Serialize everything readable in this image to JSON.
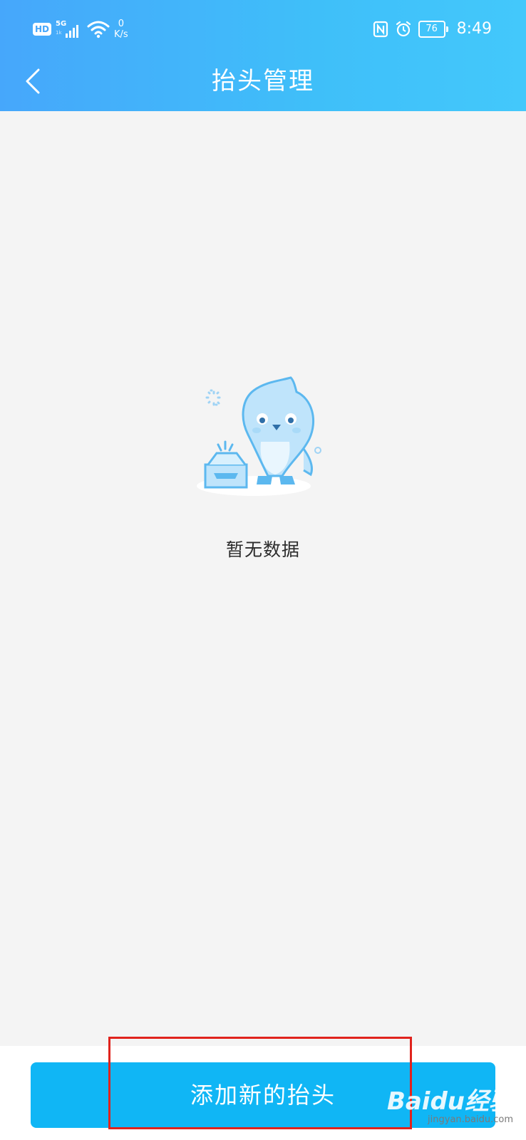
{
  "status_bar": {
    "hd": "HD",
    "network": "5G",
    "network_sub": "1k",
    "speed_value": "0",
    "speed_unit": "K/s",
    "battery": "76",
    "time": "8:49"
  },
  "nav": {
    "title": "抬头管理",
    "back_icon": "chevron-left-icon"
  },
  "empty_state": {
    "message": "暂无数据",
    "illustration": "penguin-empty-box-illustration"
  },
  "footer": {
    "add_button_label": "添加新的抬头"
  },
  "watermark": {
    "main": "Baidu经验",
    "sub": "jingyan.baidu.com"
  },
  "colors": {
    "header_start": "#46a7fb",
    "header_end": "#43c8fb",
    "button": "#10b6f5",
    "background": "#f4f4f4",
    "highlight": "#e0231d"
  }
}
